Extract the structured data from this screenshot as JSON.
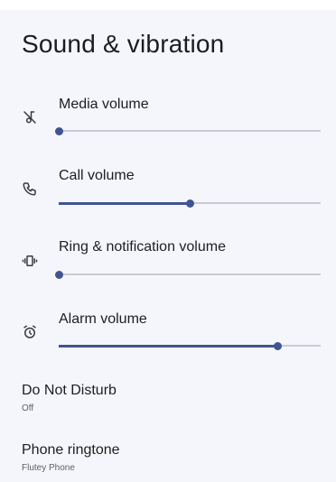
{
  "page": {
    "title": "Sound & vibration"
  },
  "volumes": [
    {
      "label": "Media volume",
      "icon": "media-muted-icon",
      "level": 0.0
    },
    {
      "label": "Call volume",
      "icon": "phone-call-icon",
      "level": 0.5
    },
    {
      "label": "Ring & notification volume",
      "icon": "vibrate-icon",
      "level": 0.0
    },
    {
      "label": "Alarm volume",
      "icon": "alarm-clock-icon",
      "level": 0.835
    }
  ],
  "settings": [
    {
      "title": "Do Not Disturb",
      "summary": "Off"
    },
    {
      "title": "Phone ringtone",
      "summary": "Flutey Phone"
    }
  ],
  "colors": {
    "accent": "#3f5491",
    "track": "#c9cad3",
    "background": "#f5f6fb"
  }
}
